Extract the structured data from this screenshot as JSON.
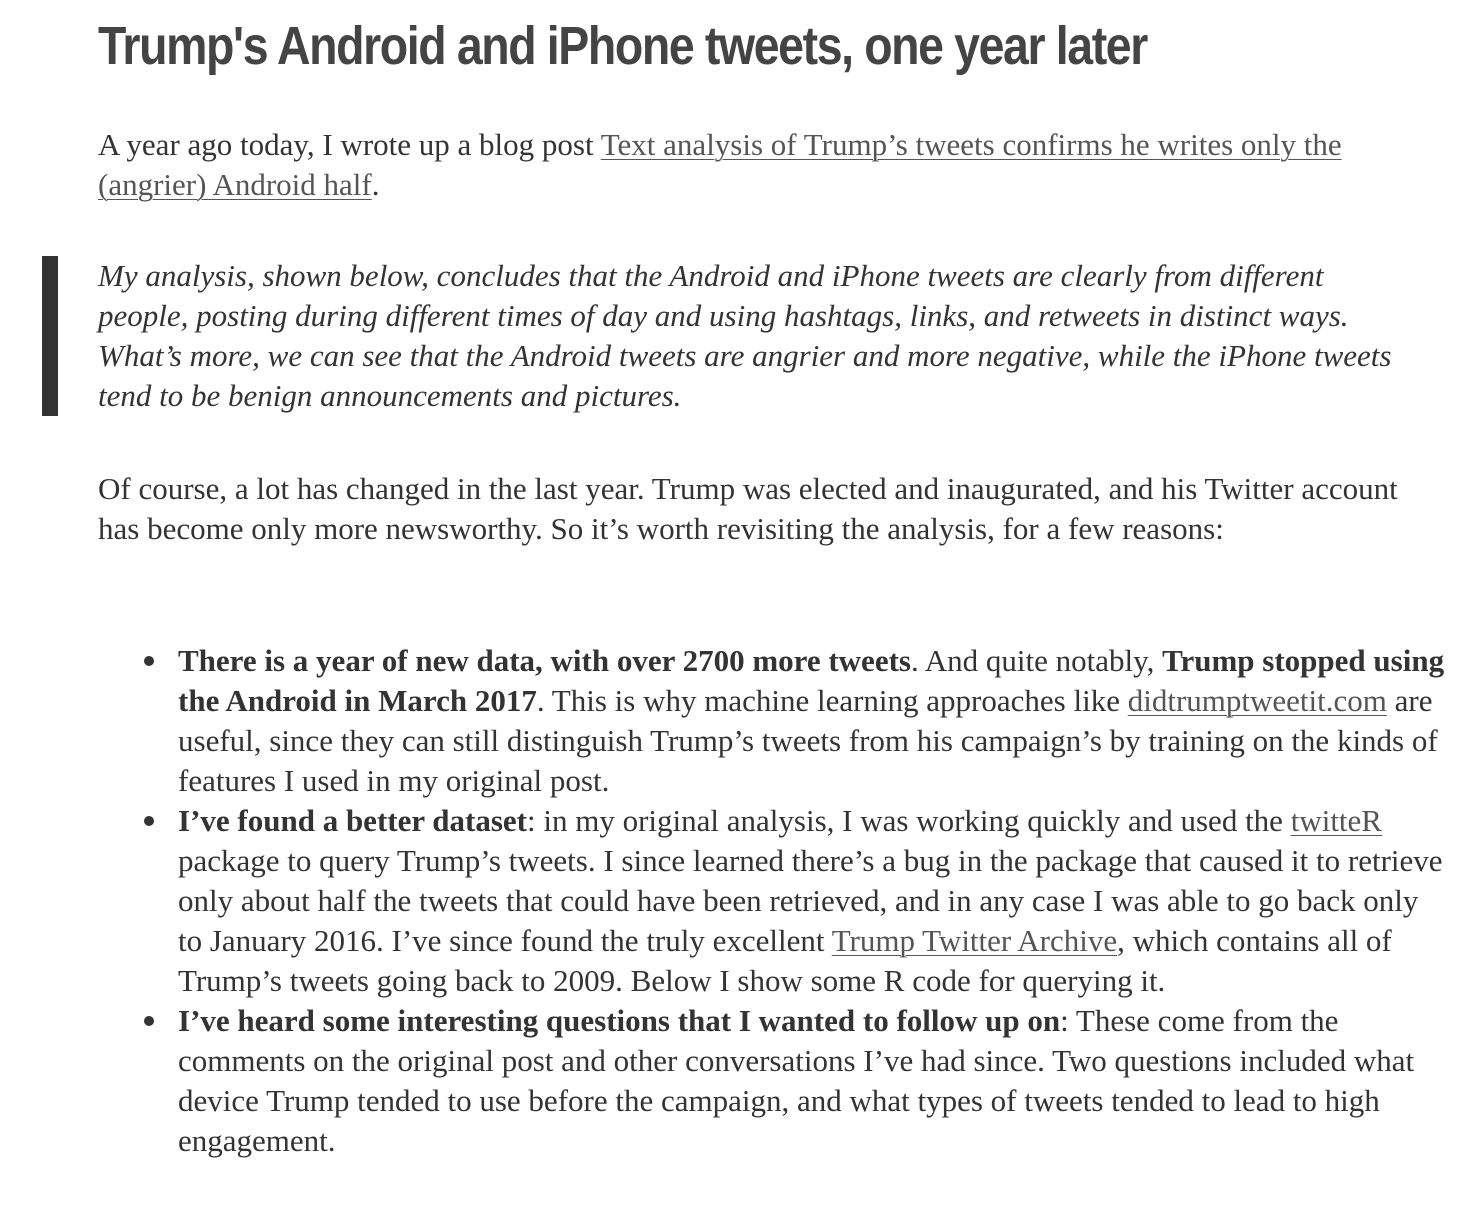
{
  "title": "Trump's Android and iPhone tweets, one year later",
  "intro": {
    "text_before": "A year ago today, I wrote up a blog post ",
    "link_text": "Text analysis of Trump’s tweets confirms he writes only the (angrier) Android half",
    "text_after": "."
  },
  "blockquote": "My analysis, shown below, concludes that the Android and iPhone tweets are clearly from different people, posting during different times of day and using hashtags, links, and retweets in distinct ways. What’s more, we can see that the Android tweets are angrier and more negative, while the iPhone tweets tend to be benign announcements and pictures.",
  "paragraph2": "Of course, a lot has changed in the last year. Trump was elected and inaugurated, and his Twitter account has become only more newsworthy. So it’s worth revisiting the analysis, for a few reasons:",
  "bullets": [
    {
      "bold1": "There is a year of new data, with over 2700 more tweets",
      "text1": ". And quite notably, ",
      "bold2": "Trump stopped using the Android in March 2017",
      "text2": ". This is why machine learning approaches like ",
      "link": "didtrumptweetit.com",
      "text3": " are useful, since they can still distinguish Trump’s tweets from his campaign’s by training on the kinds of features I used in my original post."
    },
    {
      "bold1": "I’ve found a better dataset",
      "text1": ": in my original analysis, I was working quickly and used the ",
      "link1": "twitteR",
      "text2": " package to query Trump’s tweets. I since learned there’s a bug in the package that caused it to retrieve only about half the tweets that could have been retrieved, and in any case I was able to go back only to January 2016. I’ve since found the truly excellent ",
      "link2": "Trump Twitter Archive",
      "text3": ", which contains all of Trump’s tweets going back to 2009. Below I show some R code for querying it."
    },
    {
      "bold1": "I’ve heard some interesting questions that I wanted to follow up on",
      "text1": ": These come from the comments on the original post and other conversations I’ve had since. Two questions included what device Trump tended to use before the campaign, and what types of tweets tended to lead to high engagement."
    }
  ]
}
